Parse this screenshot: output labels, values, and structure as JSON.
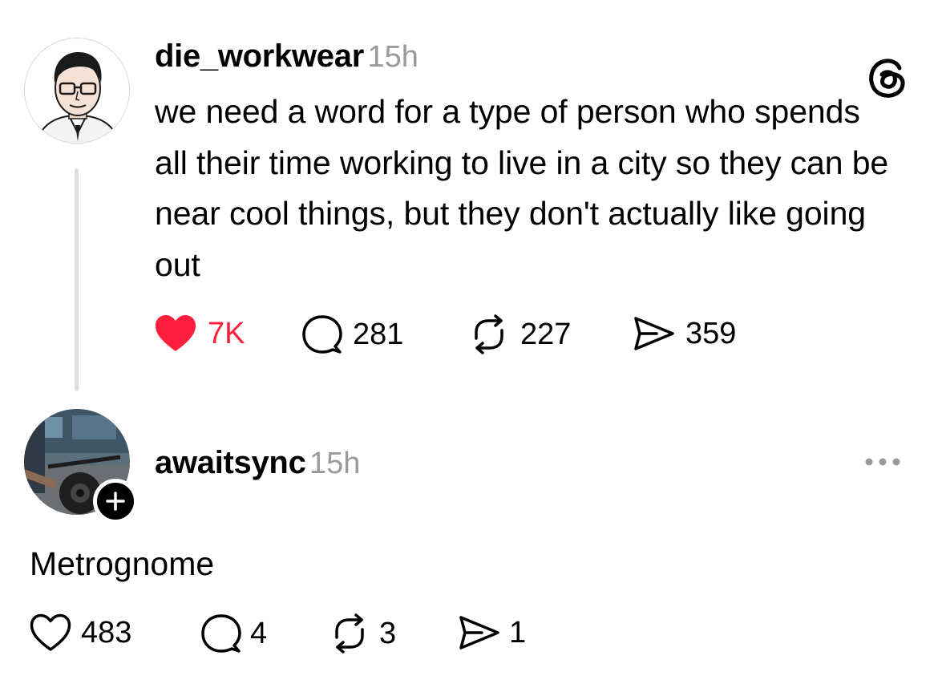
{
  "post": {
    "username": "die_workwear",
    "time": "15h",
    "text": "we need a word for a type of person who spends all their time working to live in a city so they can be near cool things, but they don't actually like going out",
    "likes": "7K",
    "replies": "281",
    "reposts": "227",
    "shares": "359",
    "liked": true
  },
  "reply": {
    "username": "awaitsync",
    "time": "15h",
    "text": "Metrognome",
    "likes": "483",
    "replies": "4",
    "reposts": "3",
    "shares": "1",
    "liked": false
  },
  "colors": {
    "like_active": "#ff1f3d",
    "muted": "#9a9a9a",
    "thread_line": "#dedede"
  },
  "icons": {
    "app_logo": "threads-logo-icon",
    "like": "heart-icon",
    "reply": "comment-icon",
    "repost": "repost-icon",
    "share": "send-icon",
    "more": "more-icon",
    "follow": "plus-icon"
  }
}
